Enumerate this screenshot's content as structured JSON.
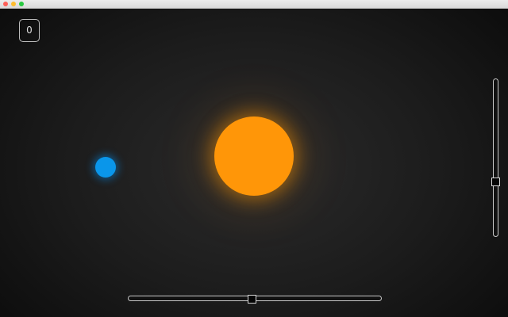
{
  "window": {
    "controls": {
      "close_color": "#fe5f57",
      "minimize_color": "#febc2e",
      "zoom_color": "#28c840"
    }
  },
  "hud": {
    "score": "0"
  },
  "scene": {
    "sun_color": "#ff9608",
    "planet_color": "#0a96ea"
  },
  "controls": {
    "horizontal_slider": {
      "value_fraction": 0.49
    },
    "vertical_slider": {
      "value_fraction": 0.35
    }
  }
}
